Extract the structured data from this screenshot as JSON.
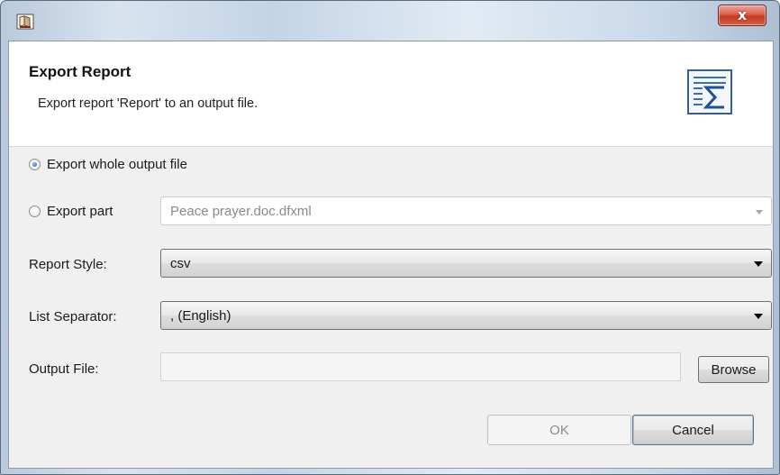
{
  "window": {
    "close_glyph": "x",
    "accent_close": "#c43a24"
  },
  "icons": {
    "app": "report-book-icon",
    "header": "sigma-report-icon",
    "close": "close-icon"
  },
  "header": {
    "title": "Export Report",
    "description": "Export report 'Report' to an output file."
  },
  "form": {
    "export_whole": {
      "label": "Export whole output file",
      "checked": true
    },
    "export_part": {
      "label": "Export part",
      "checked": false,
      "selected_value": "Peace prayer.doc.dfxml",
      "enabled": false
    },
    "report_style": {
      "label": "Report Style:",
      "selected_value": "csv"
    },
    "list_separator": {
      "label": "List Separator:",
      "selected_value": ", (English)"
    },
    "output_file": {
      "label": "Output File:",
      "value": "",
      "browse_label": "Browse"
    }
  },
  "buttons": {
    "ok_label": "OK",
    "ok_enabled": false,
    "cancel_label": "Cancel"
  }
}
